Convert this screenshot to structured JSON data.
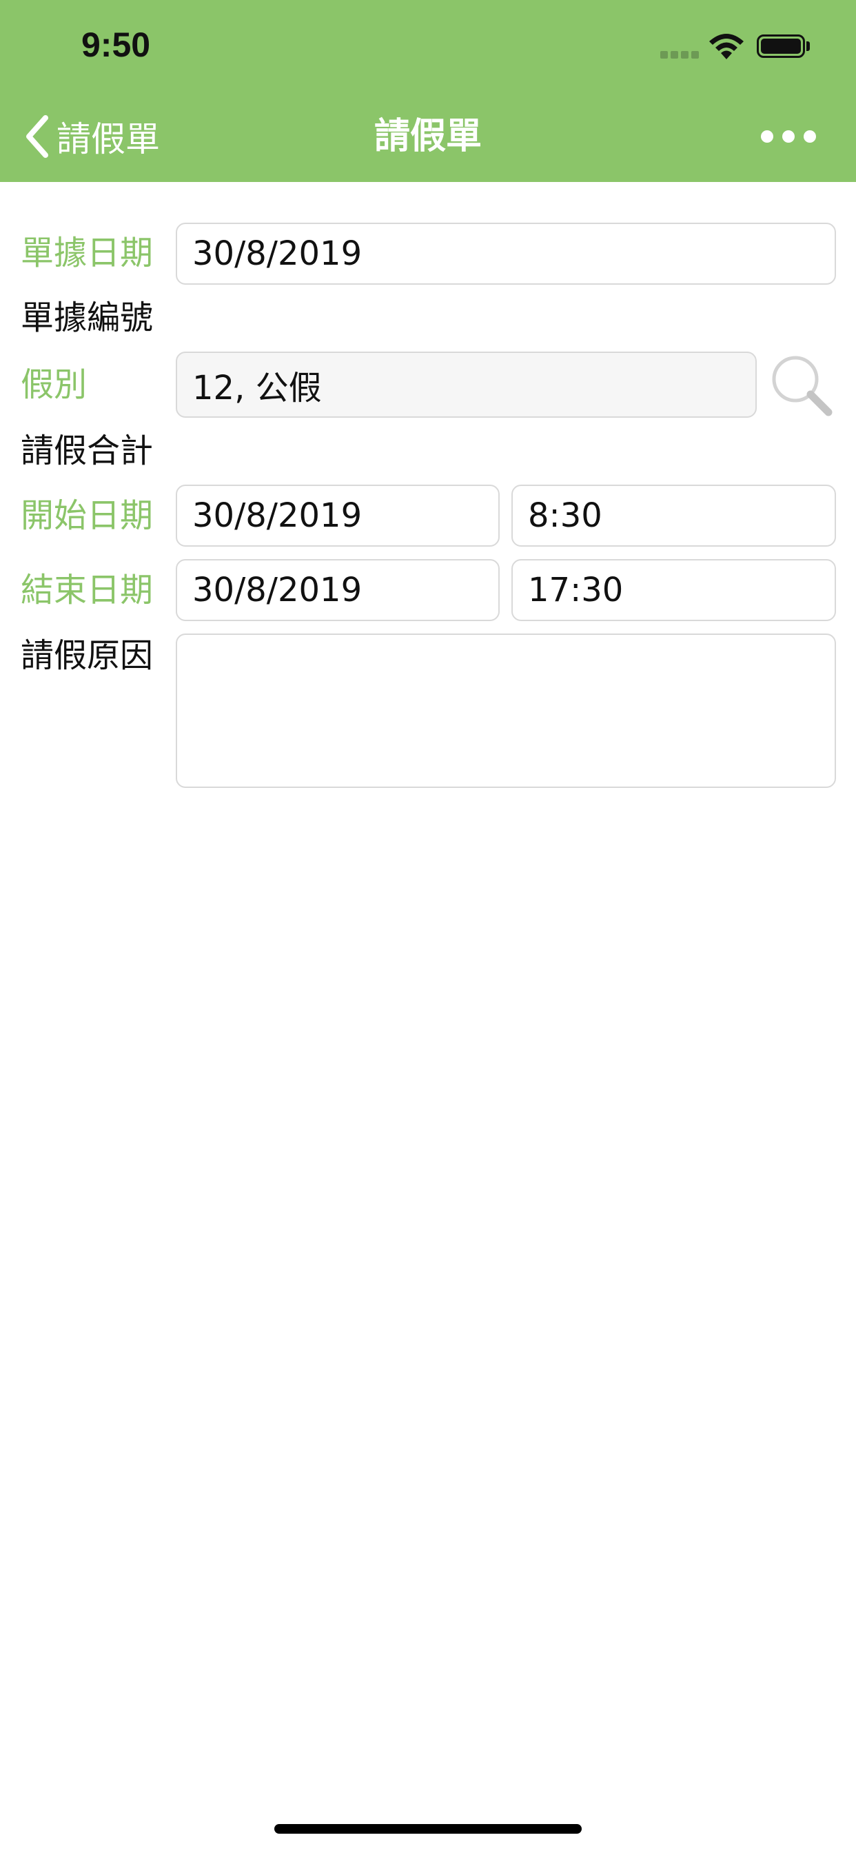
{
  "status_bar": {
    "time": "9:50"
  },
  "nav": {
    "back_label": "請假單",
    "title": "請假單"
  },
  "form": {
    "doc_date": {
      "label": "單據日期",
      "value": "30/8/2019"
    },
    "doc_no": {
      "label": "單據編號"
    },
    "leave_type": {
      "label": "假別",
      "value": "12, 公假"
    },
    "leave_total": {
      "label": "請假合計"
    },
    "start": {
      "label": "開始日期",
      "date": "30/8/2019",
      "time": "8:30"
    },
    "end": {
      "label": "結束日期",
      "date": "30/8/2019",
      "time": "17:30"
    },
    "reason": {
      "label": "請假原因",
      "value": ""
    }
  },
  "icons": {
    "back": "chevron-left-icon",
    "more": "ellipsis-icon",
    "search": "search-icon",
    "wifi": "wifi-icon",
    "battery": "battery-icon",
    "signal": "signal-icon"
  },
  "colors": {
    "accent": "#8bc569",
    "text": "#111111",
    "border": "#d9d9d9",
    "field_disabled_bg": "#f6f6f6"
  }
}
